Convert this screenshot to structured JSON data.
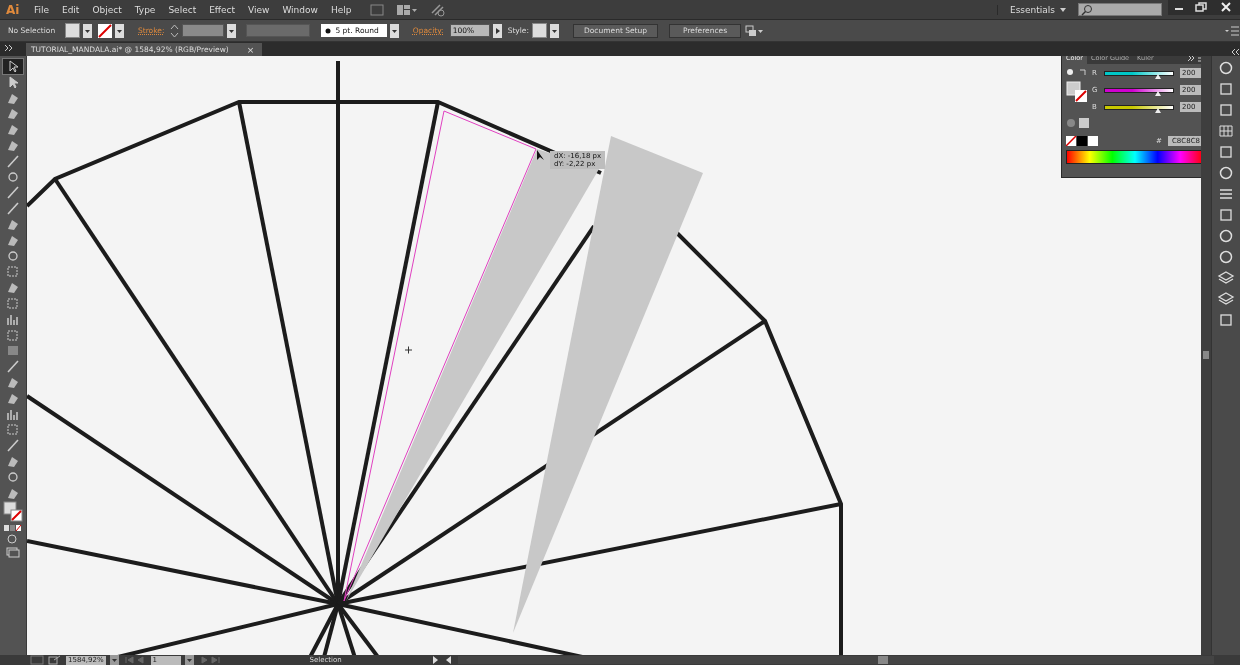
{
  "app_logo": "Ai",
  "menus": [
    {
      "label": "File"
    },
    {
      "label": "Edit"
    },
    {
      "label": "Object"
    },
    {
      "label": "Type"
    },
    {
      "label": "Select"
    },
    {
      "label": "Effect"
    },
    {
      "label": "View"
    },
    {
      "label": "Window"
    },
    {
      "label": "Help"
    }
  ],
  "workspace": "Essentials",
  "control_bar": {
    "selection": "No Selection",
    "stroke_label": "Stroke:",
    "brush": "5 pt. Round",
    "opacity_label": "Opacity:",
    "opacity": "100%",
    "style_label": "Style:",
    "buttons": [
      "Document Setup",
      "Preferences"
    ]
  },
  "document_tab": {
    "title": "TUTORIAL_MANDALA.ai* @ 1584,92% (RGB/Preview)",
    "close": "×"
  },
  "tools": [
    {
      "selected": true
    },
    {
      "selected": false
    },
    {
      "selected": false
    },
    {
      "selected": false
    },
    {
      "selected": false
    },
    {
      "selected": false
    },
    {
      "selected": false
    },
    {
      "selected": false
    },
    {
      "selected": false
    },
    {
      "selected": false
    },
    {
      "selected": false
    },
    {
      "selected": false
    },
    {
      "selected": false
    },
    {
      "selected": false
    },
    {
      "selected": false
    },
    {
      "selected": false
    },
    {
      "selected": false
    },
    {
      "selected": false
    },
    {
      "selected": false
    },
    {
      "selected": false
    },
    {
      "selected": false
    },
    {
      "selected": false
    },
    {
      "selected": false
    },
    {
      "selected": false
    },
    {
      "selected": false
    },
    {
      "selected": false
    },
    {
      "selected": false
    },
    {
      "selected": false
    }
  ],
  "canvas": {
    "tooltip": [
      "dX: -16,18 px",
      "dY: -2,22 px"
    ]
  },
  "color_panel": {
    "tabs": [
      {
        "label": "Color",
        "selected": true
      },
      {
        "label": "Color Guide",
        "selected": false
      },
      {
        "label": "Kuler",
        "selected": false
      }
    ],
    "channels": [
      {
        "label": "R",
        "color": "#00c8c8",
        "level": 0.784,
        "value": "200"
      },
      {
        "label": "G",
        "color": "#d000d0",
        "level": 0.784,
        "value": "200"
      },
      {
        "label": "B",
        "color": "#c8c800",
        "level": 0.784,
        "value": "200"
      }
    ],
    "hex_prefix": "#",
    "hex": "C8C8C8"
  },
  "status_bar": {
    "zoom": "1584,92%",
    "artboard": "1",
    "tool": "Selection"
  }
}
